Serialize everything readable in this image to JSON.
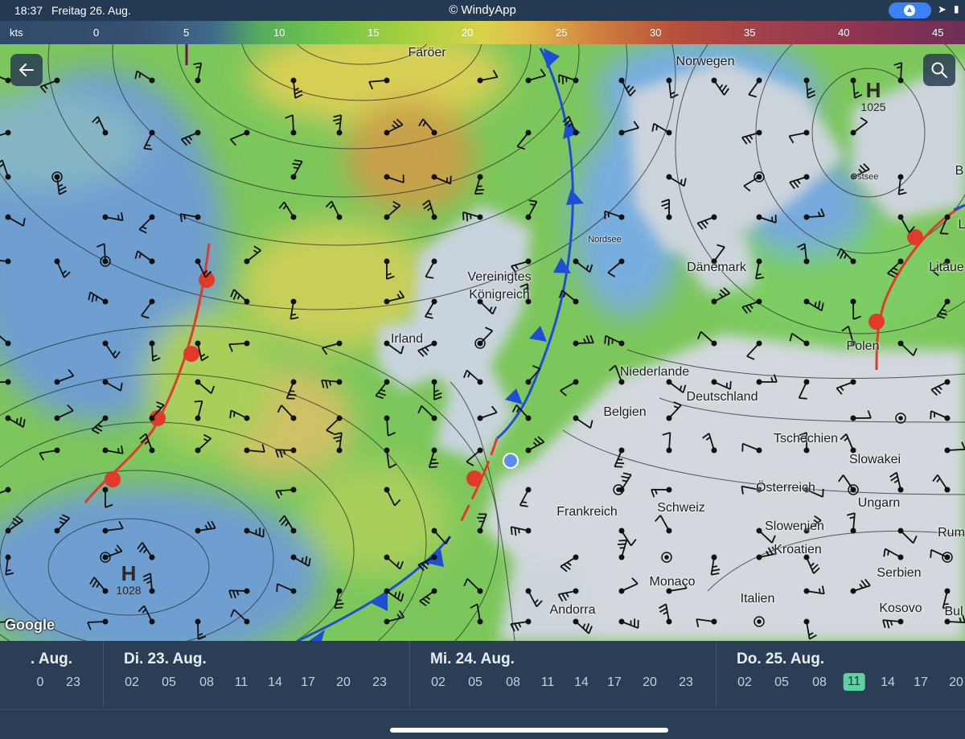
{
  "status_bar": {
    "time": "18:37",
    "date": "Freitag 26. Aug.",
    "app_title": "© WindyApp",
    "location_pill_icon": "navigation-arrow-icon",
    "location_icon": "location-arrow-icon",
    "signal_icon": "signal-icon"
  },
  "legend": {
    "unit": "kts",
    "ticks": [
      "0",
      "5",
      "10",
      "15",
      "20",
      "25",
      "30",
      "35",
      "40",
      "45"
    ]
  },
  "map": {
    "back_icon": "arrow-left-icon",
    "search_icon": "search-icon",
    "attribution": "Google",
    "labels": {
      "faeroer": "Färöer",
      "norwegen": "Norwegen",
      "nordsee": "Nordsee",
      "daenemark": "Dänemark",
      "ostsee": "Ostsee",
      "litauen": "Litaue",
      "vereinigtes_1": "Vereinigtes",
      "vereinigtes_2": "Königreich",
      "irland": "Irland",
      "niederlande": "Niederlande",
      "deutschland": "Deutschland",
      "polen": "Polen",
      "belgien": "Belgien",
      "tschechien": "Tschechien",
      "slowakei": "Slowakei",
      "oesterreich": "Österreich",
      "ungarn": "Ungarn",
      "frankreich": "Frankreich",
      "schweiz": "Schweiz",
      "slowenien": "Slowenien",
      "kroatien": "Kroatien",
      "serbien": "Serbien",
      "monaco": "Monaco",
      "italien": "Italien",
      "andorra": "Andorra",
      "kosovo": "Kosovo",
      "rum": "Rum",
      "bul": "Bul",
      "b": "B",
      "l": "L"
    },
    "pressure_systems": [
      {
        "symbol": "H",
        "value": "1025"
      },
      {
        "symbol": "H",
        "value": "1028"
      }
    ]
  },
  "timeline": {
    "days": [
      {
        "label": ". Aug.",
        "hours": [
          "0",
          "23"
        ]
      },
      {
        "label": "Di. 23. Aug.",
        "hours": [
          "02",
          "05",
          "08",
          "11",
          "14",
          "17",
          "20",
          "23"
        ]
      },
      {
        "label": "Mi. 24. Aug.",
        "hours": [
          "02",
          "05",
          "08",
          "11",
          "14",
          "17",
          "20",
          "23"
        ]
      },
      {
        "label": "Do. 25. Aug.",
        "hours": [
          "02",
          "05",
          "08",
          "11",
          "14",
          "17",
          "20"
        ]
      }
    ],
    "selected_hour": "11",
    "selected_day": "Do. 25. Aug.",
    "selected_color": "#5fd1a4"
  },
  "colors": {
    "warm_front": "#e23a2a",
    "cold_front": "#1d4fd6",
    "current_location": "#5b8def"
  }
}
